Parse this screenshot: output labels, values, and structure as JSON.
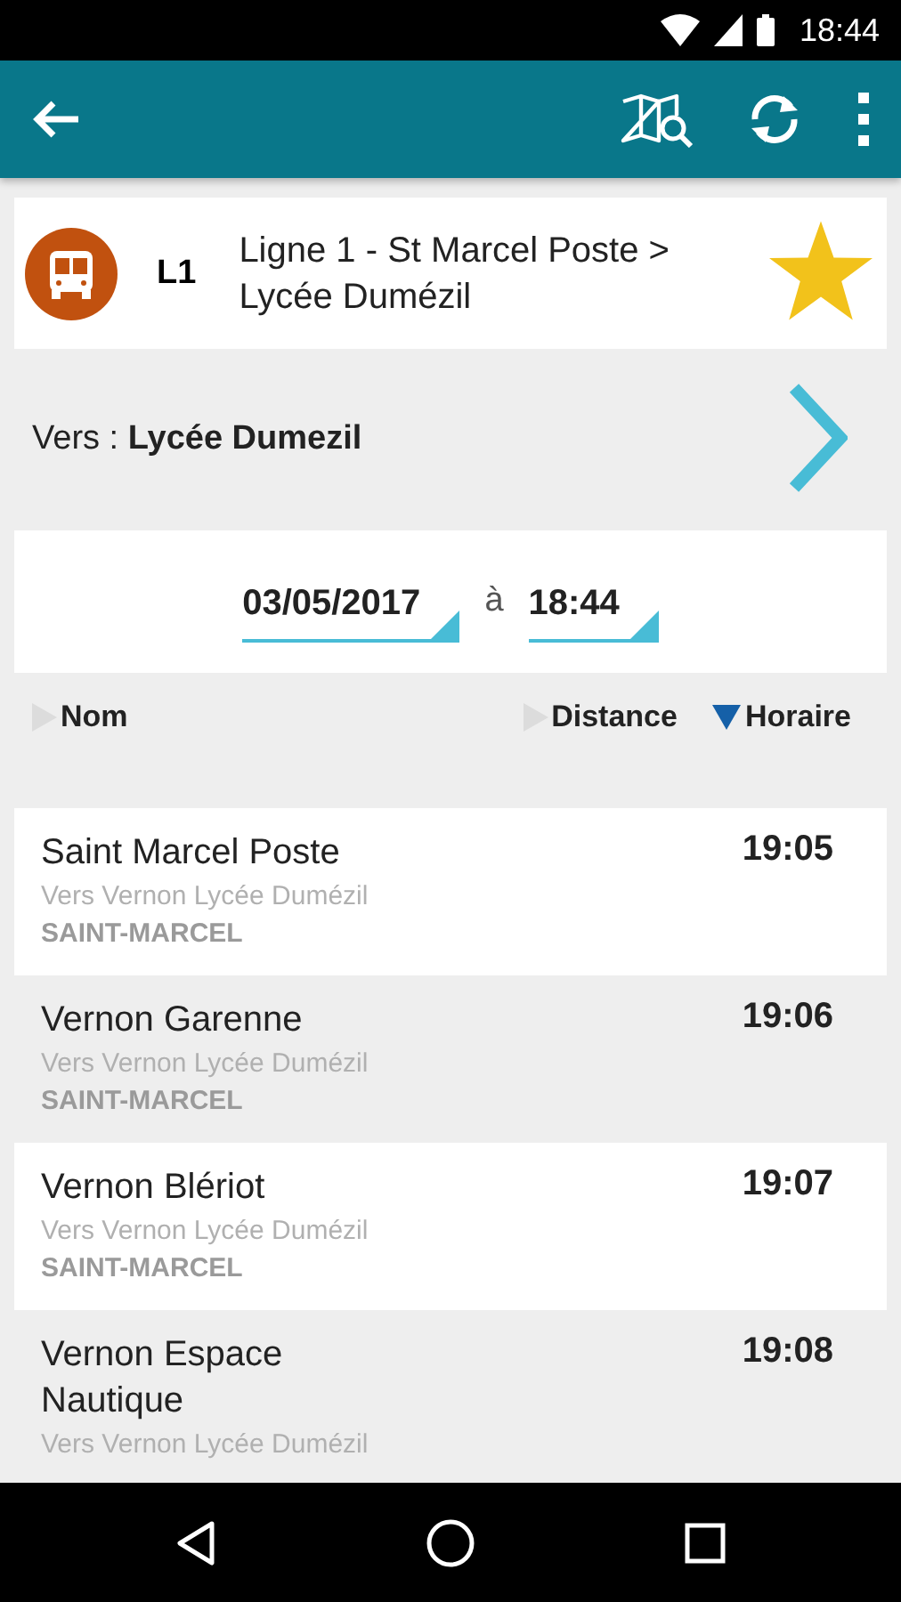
{
  "status_bar": {
    "time": "18:44"
  },
  "line": {
    "code": "L1",
    "name": "Ligne 1 - St Marcel Poste > Lycée Dumézil",
    "favorite": true
  },
  "direction": {
    "label": "Vers :",
    "value": "Lycée Dumezil"
  },
  "date_time": {
    "date": "03/05/2017",
    "separator": "à",
    "time": "18:44"
  },
  "sort_columns": [
    {
      "label": "Nom",
      "selected": false
    },
    {
      "label": "Distance",
      "selected": false
    },
    {
      "label": "Horaire",
      "selected": true
    }
  ],
  "stops": [
    {
      "name": "Saint Marcel Poste",
      "direction": "Vers Vernon Lycée Dumézil",
      "town": "SAINT-MARCEL",
      "time": "19:05"
    },
    {
      "name": "Vernon Garenne",
      "direction": "Vers Vernon Lycée Dumézil",
      "town": "SAINT-MARCEL",
      "time": "19:06"
    },
    {
      "name": "Vernon Blériot",
      "direction": "Vers Vernon Lycée Dumézil",
      "town": "SAINT-MARCEL",
      "time": "19:07"
    },
    {
      "name": "Vernon Espace Nautique",
      "direction": "Vers Vernon Lycée Dumézil",
      "time": "19:08"
    }
  ]
}
